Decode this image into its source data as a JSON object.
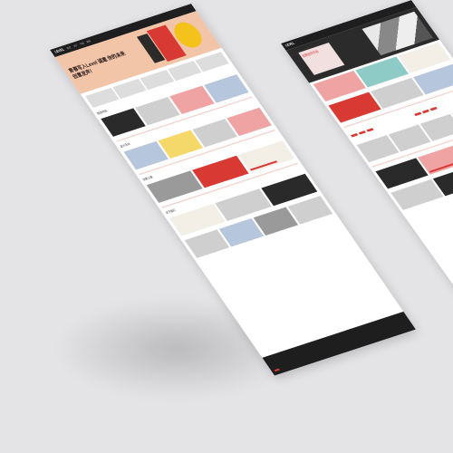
{
  "front_page": {
    "nav": {
      "logo": "LEVEL",
      "links": [
        "首页",
        "关于",
        "作品",
        "联系"
      ]
    },
    "hero": {
      "headline": "青春写入Level 诚邀 你的未来创意发声！"
    },
    "sections": [
      {
        "title": "精选作品"
      },
      {
        "title": "设计活动"
      },
      {
        "title": "创意人群"
      },
      {
        "title": "关于我们"
      }
    ]
  },
  "back_page": {
    "nav": {
      "logo": "LEVEL"
    },
    "hero": {
      "headline": "创意创作作品"
    }
  },
  "colors": {
    "accent": "#d83a33",
    "hero_bg": "#f2c5a8",
    "dark": "#1e1e1e",
    "background": "#e4e3e6"
  }
}
